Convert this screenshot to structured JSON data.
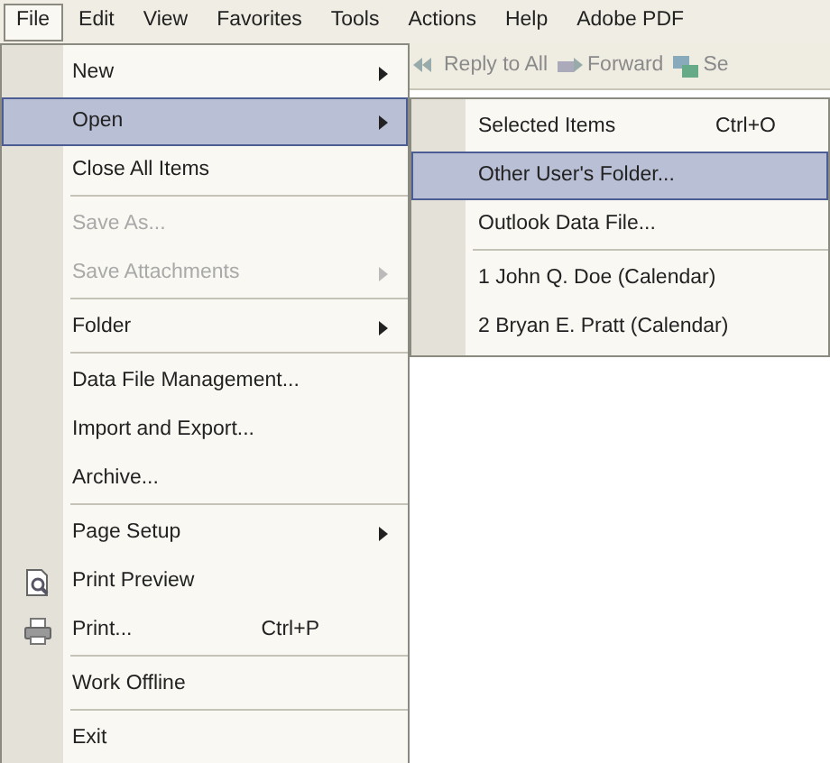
{
  "menu_bar": [
    {
      "label": "File",
      "selected": true
    },
    {
      "label": "Edit",
      "selected": false
    },
    {
      "label": "View",
      "selected": false
    },
    {
      "label": "Favorites",
      "selected": false
    },
    {
      "label": "Tools",
      "selected": false
    },
    {
      "label": "Actions",
      "selected": false
    },
    {
      "label": "Help",
      "selected": false
    },
    {
      "label": "Adobe PDF",
      "selected": false
    }
  ],
  "toolbar": [
    {
      "label": "Reply to All",
      "kind": "reply-all"
    },
    {
      "label": "Forward",
      "kind": "forward"
    },
    {
      "label": "Se",
      "kind": "send"
    }
  ],
  "file_menu": [
    {
      "label": "New",
      "submenu": true,
      "disabled": false,
      "selected": false,
      "separator_after": false
    },
    {
      "label": "Open",
      "submenu": true,
      "disabled": false,
      "selected": true,
      "separator_after": false
    },
    {
      "label": "Close All Items",
      "submenu": false,
      "disabled": false,
      "selected": false,
      "separator_after": true
    },
    {
      "label": "Save As...",
      "submenu": false,
      "disabled": true,
      "selected": false,
      "separator_after": false
    },
    {
      "label": "Save Attachments",
      "submenu": true,
      "disabled": true,
      "selected": false,
      "separator_after": true
    },
    {
      "label": "Folder",
      "submenu": true,
      "disabled": false,
      "selected": false,
      "separator_after": true
    },
    {
      "label": "Data File Management...",
      "submenu": false,
      "disabled": false,
      "selected": false,
      "separator_after": false
    },
    {
      "label": "Import and Export...",
      "submenu": false,
      "disabled": false,
      "selected": false,
      "separator_after": false
    },
    {
      "label": "Archive...",
      "submenu": false,
      "disabled": false,
      "selected": false,
      "separator_after": true
    },
    {
      "label": "Page Setup",
      "submenu": true,
      "disabled": false,
      "selected": false,
      "separator_after": false
    },
    {
      "label": "Print Preview",
      "submenu": false,
      "disabled": false,
      "selected": false,
      "separator_after": false,
      "kind": "preview"
    },
    {
      "label": "Print...",
      "shortcut": "Ctrl+P",
      "submenu": false,
      "disabled": false,
      "selected": false,
      "separator_after": true,
      "kind": "print"
    },
    {
      "label": "Work Offline",
      "submenu": false,
      "disabled": false,
      "selected": false,
      "separator_after": true
    },
    {
      "label": "Exit",
      "submenu": false,
      "disabled": false,
      "selected": false,
      "separator_after": false
    }
  ],
  "open_submenu": [
    {
      "label": "Selected Items",
      "shortcut": "Ctrl+O",
      "selected": false,
      "separator_after": false
    },
    {
      "label": "Other User's Folder...",
      "selected": true,
      "separator_after": false
    },
    {
      "label": "Outlook Data File...",
      "selected": false,
      "separator_after": true
    },
    {
      "label": "1 John Q. Doe (Calendar)",
      "selected": false,
      "separator_after": false
    },
    {
      "label": "2 Bryan E. Pratt (Calendar)",
      "selected": false,
      "separator_after": false
    }
  ]
}
